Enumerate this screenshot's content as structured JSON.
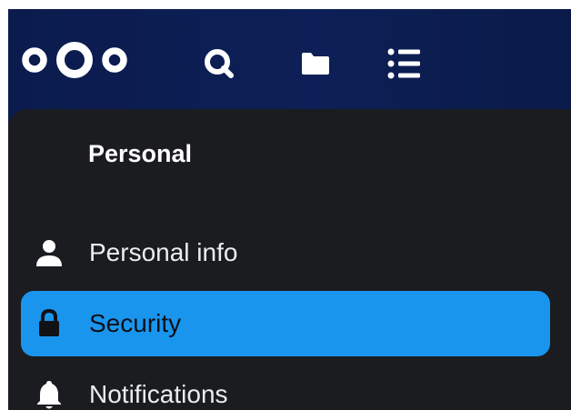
{
  "header": {
    "icons": [
      "nextcloud-logo",
      "search-icon",
      "folder-icon",
      "activity-list-icon"
    ]
  },
  "settings_nav": {
    "section_title": "Personal",
    "items": [
      {
        "label": "Personal info",
        "icon": "person-icon",
        "active": false
      },
      {
        "label": "Security",
        "icon": "lock-icon",
        "active": true
      },
      {
        "label": "Notifications",
        "icon": "bell-icon",
        "active": false
      }
    ]
  },
  "colors": {
    "header_bg": "#0c1c50",
    "panel_bg": "#1b1c20",
    "active_item": "#1a95ee",
    "text": "#ecedf0"
  }
}
